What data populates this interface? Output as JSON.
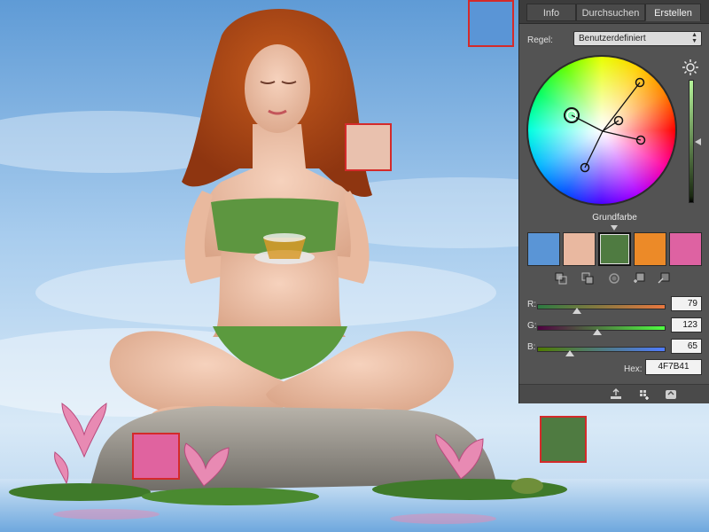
{
  "panel": {
    "tabs": [
      {
        "label": "Info",
        "active": false
      },
      {
        "label": "Durchsuchen",
        "active": false
      },
      {
        "label": "Erstellen",
        "active": true
      }
    ],
    "rule_label": "Regel:",
    "rule_value": "Benutzerdefiniert",
    "base_color_label": "Grundfarbe",
    "theme_colors": [
      "#5a95d6",
      "#e9b8a0",
      "#4f7b41",
      "#ec8a28",
      "#de62a2"
    ],
    "selected_theme_index": 2,
    "rgb": {
      "r_label": "R:",
      "r_value": "79",
      "g_label": "G:",
      "g_value": "123",
      "b_label": "B:",
      "b_value": "65"
    },
    "hex_label": "Hex:",
    "hex_value": "4F7B41",
    "icons": {
      "tools": [
        "set-foreground-color-icon",
        "set-background-color-icon",
        "swap-color-icon",
        "add-to-swatches-icon",
        "add-to-themes-icon"
      ],
      "bottom": [
        "upload-icon",
        "save-theme-icon",
        "online-info-icon"
      ]
    }
  },
  "samples": {
    "blue": "#5a95d6",
    "skin": "#e9c1ae",
    "pink": "#e0639f",
    "green": "#4f7b41"
  }
}
